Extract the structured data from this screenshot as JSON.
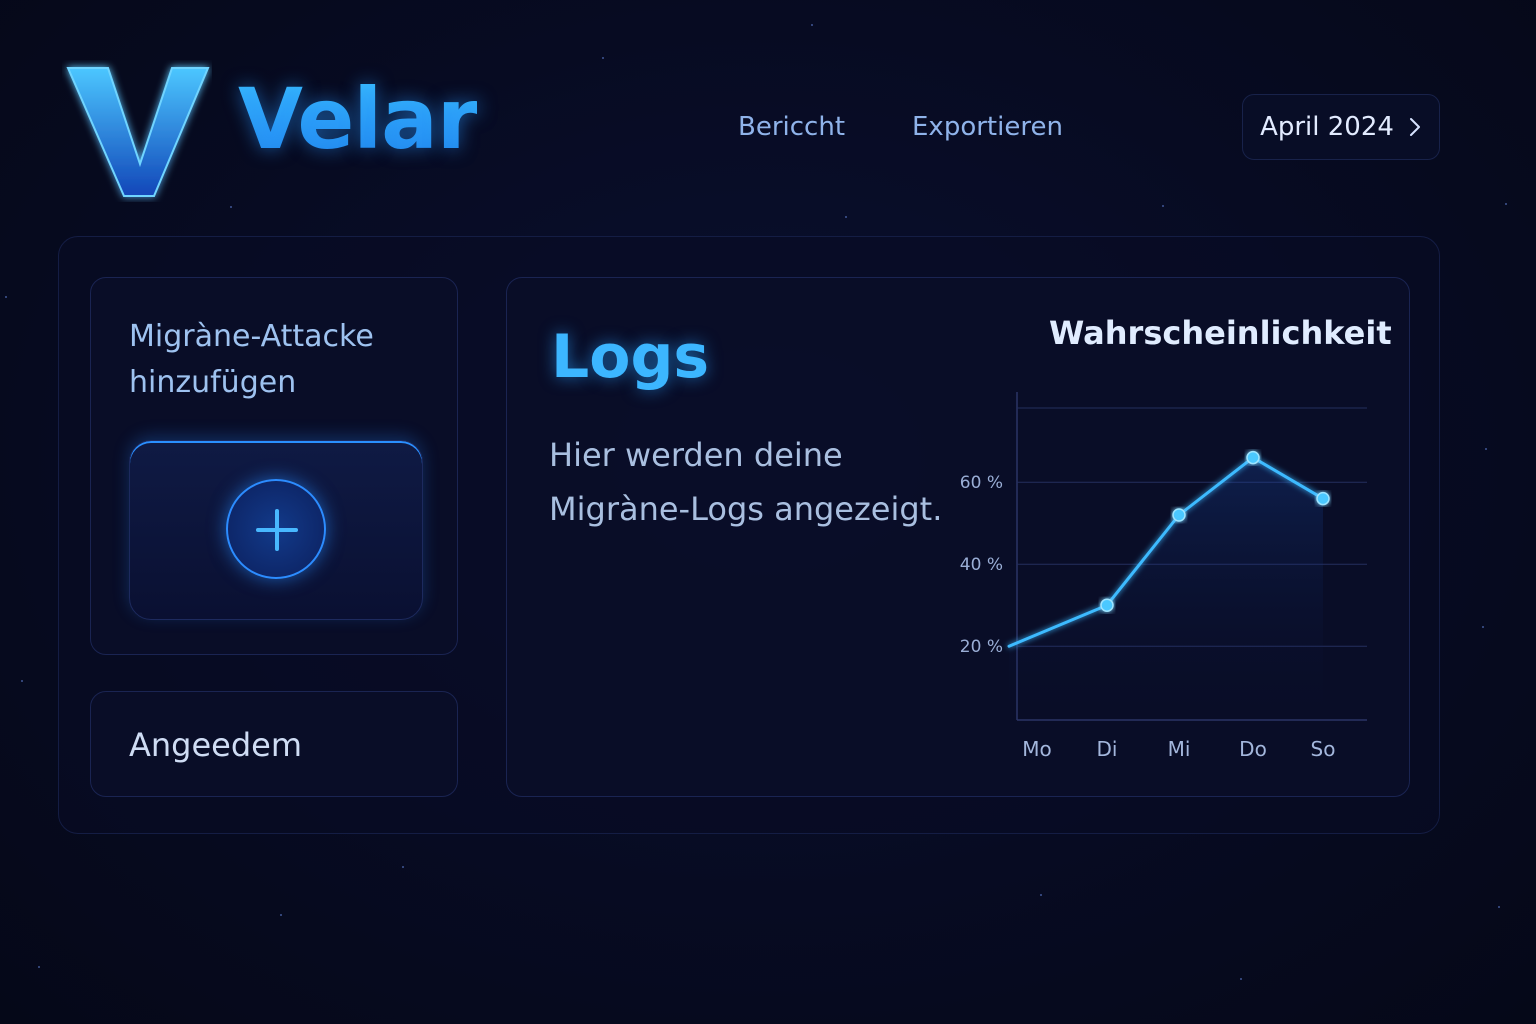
{
  "app": {
    "brand": "Velar"
  },
  "header": {
    "nav": [
      {
        "label": "Bericcht"
      },
      {
        "label": "Exportieren"
      }
    ],
    "month_selector": {
      "label": "April 2024",
      "icon": "chevron-right-icon"
    }
  },
  "sidebar": {
    "add_card": {
      "title_line1": "Migràne-Attacke",
      "title_line2": "hinzufügen",
      "button_icon": "plus-icon"
    },
    "secondary_card": {
      "label": "Angeedem"
    }
  },
  "main": {
    "title": "Logs",
    "description_line1": "Hier werden deine",
    "description_line2": "Migràne-Logs angezeigt."
  },
  "colors": {
    "background": "#070b22",
    "accent": "#2aa6ff",
    "line": "#3cbaff"
  },
  "chart_data": {
    "type": "line",
    "title": "Wahrscheinlichkeit",
    "categories": [
      "Mo",
      "Di",
      "Mi",
      "Do",
      "So"
    ],
    "x_positions": [
      0,
      1,
      2,
      3,
      4
    ],
    "series": [
      {
        "values": [
          20,
          30,
          52,
          66,
          56
        ],
        "markers": [
          false,
          true,
          true,
          true,
          true
        ]
      }
    ],
    "y_ticks": [
      20,
      40,
      60
    ],
    "y_tick_labels": [
      "20 %",
      "40 %",
      "60 %"
    ],
    "ylim": [
      2,
      82
    ],
    "grid": true,
    "xlabel": "",
    "ylabel": ""
  }
}
